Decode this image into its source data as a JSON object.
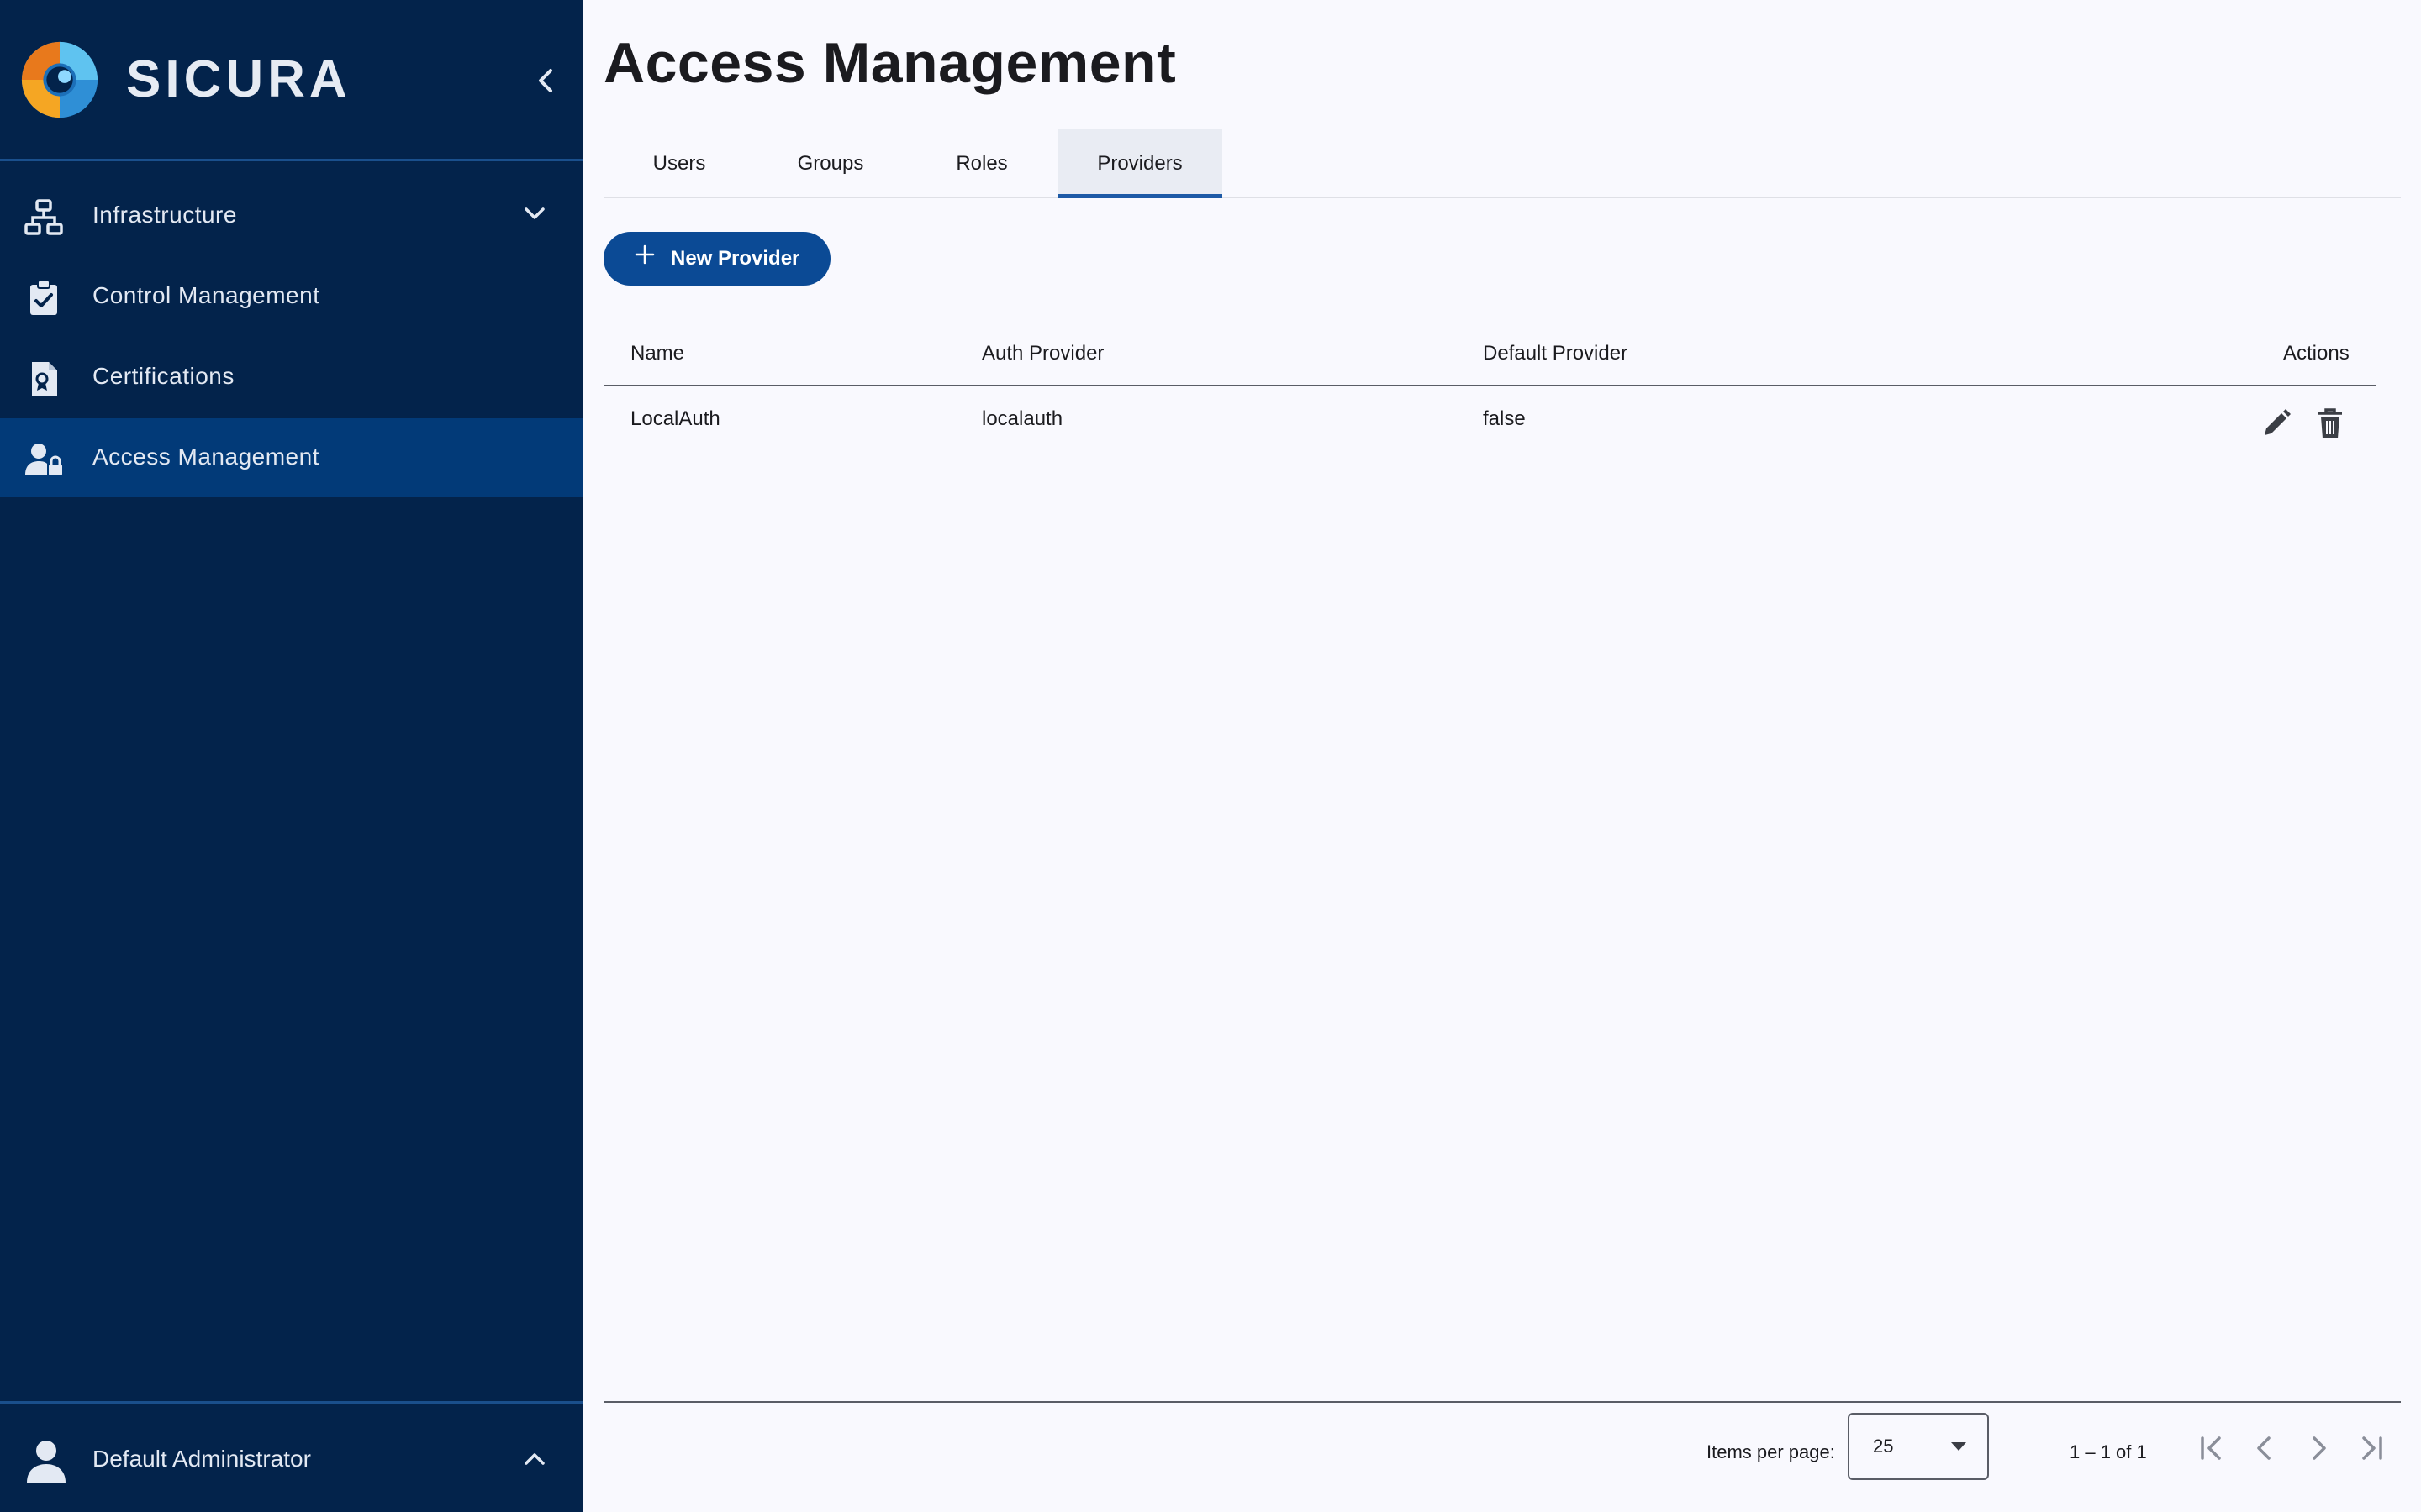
{
  "brand": {
    "name": "SICURA",
    "logo_icon": "sicura-logo-icon"
  },
  "sidebar": {
    "collapse_icon": "chevron-left-icon",
    "items": [
      {
        "label": "Infrastructure",
        "icon": "network-icon",
        "expand_icon": "chevron-down-icon"
      },
      {
        "label": "Control Management",
        "icon": "clipboard-check-icon"
      },
      {
        "label": "Certifications",
        "icon": "certificate-document-icon"
      },
      {
        "label": "Access Management",
        "icon": "user-lock-icon",
        "active": true
      }
    ],
    "footer": {
      "user": "Default Administrator",
      "icon": "user-icon",
      "expand_icon": "chevron-up-icon"
    }
  },
  "colors": {
    "sidebar_bg": "#03234b",
    "sidebar_active": "#023a78",
    "primary": "#0b4a95",
    "tab_indicator": "#1e5aa6",
    "page_bg": "#f9f9fe",
    "logo_orange": "#f5a623",
    "logo_blue": "#2f8fd6"
  },
  "page": {
    "title": "Access Management"
  },
  "tabs": [
    "Users",
    "Groups",
    "Roles",
    "Providers"
  ],
  "active_tab": "Providers",
  "toolbar": {
    "new_label": "New Provider",
    "new_icon": "plus-icon"
  },
  "table": {
    "columns": [
      "Name",
      "Auth Provider",
      "Default Provider",
      "Actions"
    ],
    "rows": [
      {
        "name": "LocalAuth",
        "auth_provider": "localauth",
        "default_provider": "false",
        "actions": [
          "edit-icon",
          "delete-icon"
        ]
      }
    ]
  },
  "paginator": {
    "items_per_page_label": "Items per page:",
    "items_per_page": "25",
    "range": "1 – 1 of 1",
    "nav_icons": [
      "first-page-icon",
      "previous-page-icon",
      "next-page-icon",
      "last-page-icon"
    ]
  }
}
